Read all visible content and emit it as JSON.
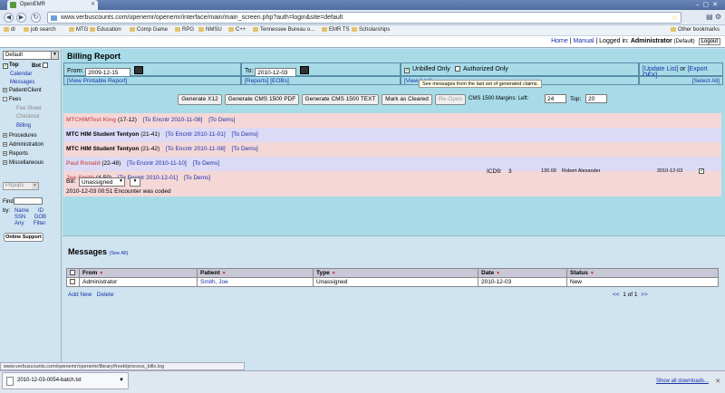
{
  "browser": {
    "tab_title": "OpenEMR",
    "url": "www.verbuscounts.com/openemr/openemr/interface/main/main_screen.php?auth=login&site=default",
    "bookmarks": [
      "dl",
      "job search",
      "MTG",
      "Education",
      "Comp Game",
      "RPG",
      "NMSU",
      "C++",
      "Tennessee Bureau o...",
      "EMR TS",
      "Scholarships"
    ],
    "other_bookmarks": "Other bookmarks",
    "status_url": "www.verbuscounts.com/openemr/openemr/library/freeb/process_bills.log",
    "download_file": "2010-12-03-0054-batch.txt",
    "show_all_downloads": "Show all downloads..."
  },
  "header": {
    "home": "Home",
    "manual": "Manual",
    "logged_in_label": "Logged in:",
    "user": "Administrator",
    "user_suffix": "(Default)",
    "logout": "Logout"
  },
  "sidebar": {
    "lang": "Default",
    "top_label": "Top",
    "bot_label": "Bot",
    "items": {
      "calendar": "Calendar",
      "messages": "Messages",
      "patient_client": "Patient/Client",
      "fees": "Fees",
      "fee_sheet": "Fee Sheet",
      "checkout": "Checkout",
      "billing": "Billing",
      "procedures": "Procedures",
      "administration": "Administration",
      "reports": "Reports",
      "miscellaneous": "Miscellaneous"
    },
    "popups": "Popups",
    "find_label": "Find:",
    "by_label": "by:",
    "find_options": [
      "Name",
      "ID",
      "SSN",
      "DOB",
      "Any",
      "Filter"
    ],
    "online_support": "Online Support"
  },
  "billing": {
    "title": "Billing Report",
    "from_label": "From:",
    "from_value": "2009-12-15",
    "to_label": "To:",
    "to_value": "2010-12-03",
    "unbilled_only": "Unbilled Only",
    "authorized_only": "Authorized Only",
    "update_list": "[Update List]",
    "or": "or",
    "export_ofx": "[Export OFX]",
    "view_printable": "[View Printable Report]",
    "reports": "[Reports]",
    "eobs": "[EOBs]",
    "view_log": "[View Log]",
    "select_all": "[Select All]",
    "tooltip": "See messages from the last set of generated claims.",
    "buttons": {
      "gen_x12": "Generate X12",
      "gen_cms_pdf": "Generate CMS 1500 PDF",
      "gen_cms_text": "Generate CMS 1500 TEXT",
      "mark_cleared": "Mark as Cleared",
      "reopen": "Re-Open"
    },
    "margins_label": "CMS 1500 Margins: Left:",
    "left_margin": "24",
    "top_label": "Top:",
    "top_margin": "20",
    "rows": [
      {
        "name": "MTCHIMTest King",
        "pid": "(17-12)",
        "encounter": "[To Encntr 2010-11-08]",
        "dems": "[To Dems]"
      },
      {
        "name": "MTC HIM Student Tentyon",
        "pid": "(21-41)",
        "encounter": "[To Encntr 2010-11-01]",
        "dems": "[To Dems]"
      },
      {
        "name": "MTC HIM Student Tentyon",
        "pid": "(21-42)",
        "encounter": "[To Encntr 2010-11-08]",
        "dems": "[To Dems]"
      },
      {
        "name": "Paul Ronald",
        "pid": "(22-48)",
        "encounter": "[To Encntr 2010-11-10]",
        "dems": "[To Dems]"
      },
      {
        "name": "Joe Smith",
        "pid": "(4-50)",
        "encounter": "[To Encntr 2010-12-01]",
        "dems": "[To Dems]"
      }
    ],
    "detail": {
      "code_type": "ICD9:",
      "code": "3",
      "amount": "130.00",
      "provider": "Robert Alexander",
      "date": "2010-12-03",
      "bill_label": "Bill:",
      "bill_value": "Unassigned",
      "note": "2010-12-03 00:51 Encounter was coded"
    }
  },
  "messages": {
    "title": "Messages",
    "see_all": "(See All)",
    "columns": [
      "From",
      "Patient",
      "Type",
      "Date",
      "Status"
    ],
    "rows": [
      {
        "from": "Administrator",
        "patient": "Smith, Joe",
        "type": "Unassigned",
        "date": "2010-12-03",
        "status": "New"
      }
    ],
    "add_new": "Add New",
    "delete": "Delete",
    "pager_prev": "<<",
    "pager_text": "1 of 1",
    "pager_next": ">>"
  }
}
